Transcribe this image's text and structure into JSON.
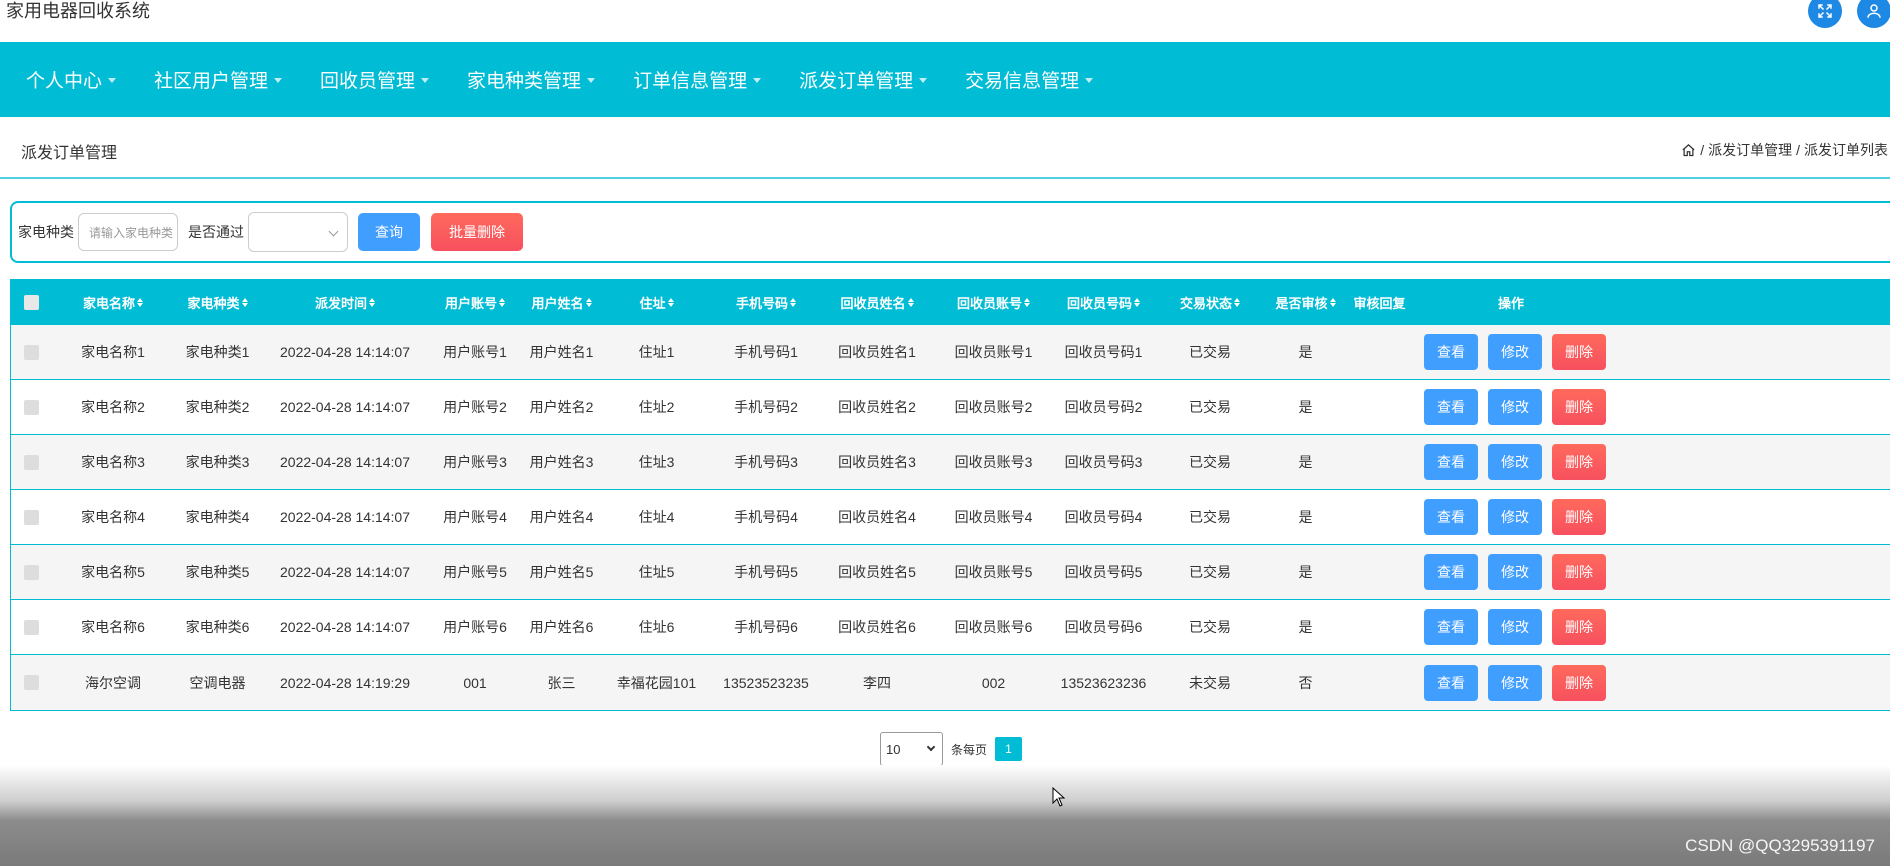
{
  "app": {
    "title": "家用电器回收系统"
  },
  "nav": {
    "items": [
      {
        "label": "个人中心"
      },
      {
        "label": "社区用户管理"
      },
      {
        "label": "回收员管理"
      },
      {
        "label": "家电种类管理"
      },
      {
        "label": "订单信息管理"
      },
      {
        "label": "派发订单管理"
      },
      {
        "label": "交易信息管理"
      }
    ]
  },
  "page": {
    "title": "派发订单管理",
    "breadcrumb": [
      "派发订单管理",
      "派发订单列表"
    ]
  },
  "search": {
    "category_label": "家电种类",
    "category_placeholder": "请输入家电种类",
    "approved_label": "是否通过",
    "approved_value": "",
    "query_label": "查询",
    "batch_delete_label": "批量删除"
  },
  "table": {
    "headers": [
      "家电名称",
      "家电种类",
      "派发时间",
      "用户账号",
      "用户姓名",
      "住址",
      "手机号码",
      "回收员姓名",
      "回收员账号",
      "回收员号码",
      "交易状态",
      "是否审核",
      "审核回复",
      "操作"
    ],
    "rows": [
      [
        "家电名称1",
        "家电种类1",
        "2022-04-28 14:14:07",
        "用户账号1",
        "用户姓名1",
        "住址1",
        "手机号码1",
        "回收员姓名1",
        "回收员账号1",
        "回收员号码1",
        "已交易",
        "是",
        ""
      ],
      [
        "家电名称2",
        "家电种类2",
        "2022-04-28 14:14:07",
        "用户账号2",
        "用户姓名2",
        "住址2",
        "手机号码2",
        "回收员姓名2",
        "回收员账号2",
        "回收员号码2",
        "已交易",
        "是",
        ""
      ],
      [
        "家电名称3",
        "家电种类3",
        "2022-04-28 14:14:07",
        "用户账号3",
        "用户姓名3",
        "住址3",
        "手机号码3",
        "回收员姓名3",
        "回收员账号3",
        "回收员号码3",
        "已交易",
        "是",
        ""
      ],
      [
        "家电名称4",
        "家电种类4",
        "2022-04-28 14:14:07",
        "用户账号4",
        "用户姓名4",
        "住址4",
        "手机号码4",
        "回收员姓名4",
        "回收员账号4",
        "回收员号码4",
        "已交易",
        "是",
        ""
      ],
      [
        "家电名称5",
        "家电种类5",
        "2022-04-28 14:14:07",
        "用户账号5",
        "用户姓名5",
        "住址5",
        "手机号码5",
        "回收员姓名5",
        "回收员账号5",
        "回收员号码5",
        "已交易",
        "是",
        ""
      ],
      [
        "家电名称6",
        "家电种类6",
        "2022-04-28 14:14:07",
        "用户账号6",
        "用户姓名6",
        "住址6",
        "手机号码6",
        "回收员姓名6",
        "回收员账号6",
        "回收员号码6",
        "已交易",
        "是",
        ""
      ],
      [
        "海尔空调",
        "空调电器",
        "2022-04-28 14:19:29",
        "001",
        "张三",
        "幸福花园101",
        "13523523235",
        "李四",
        "002",
        "13523623236",
        "未交易",
        "否",
        ""
      ]
    ],
    "actions": {
      "view": "查看",
      "edit": "修改",
      "delete": "删除"
    }
  },
  "pagination": {
    "page_size": "10",
    "per_page_label": "条每页",
    "current_page": "1"
  },
  "watermark": "CSDN @QQ3295391197",
  "colors": {
    "primary": "#00bcd4",
    "button_blue": "#409eff",
    "button_red": "#f7505f"
  }
}
